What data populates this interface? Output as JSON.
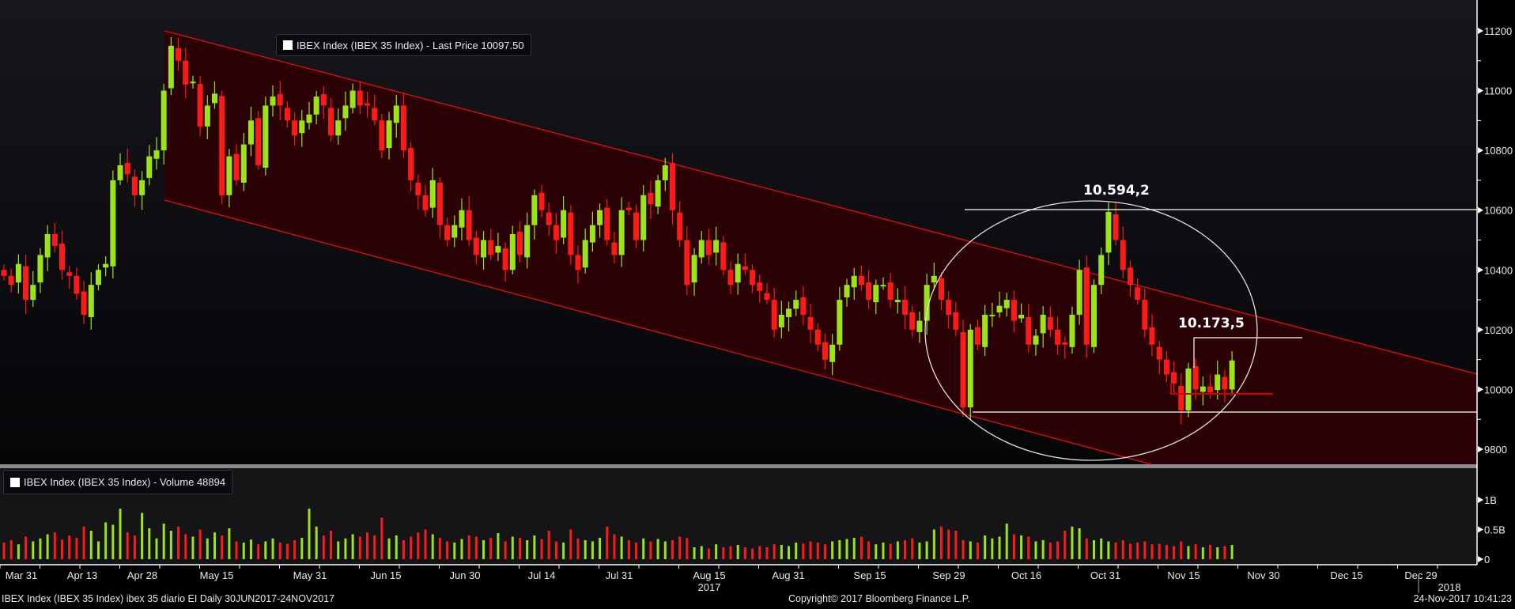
{
  "chart_data": {
    "type": "candlestick",
    "title": "IBEX Index (IBEX 35 Index) ibex 35 diario EI  Daily 30JUN2017-24NOV2017",
    "price_legend": "IBEX Index (IBEX 35 Index) - Last Price  10097.50",
    "volume_legend": "IBEX Index (IBEX 35 Index) - Volume 48894",
    "ylim": [
      9750,
      11250
    ],
    "y_ticks": [
      "11200",
      "11000",
      "10800",
      "10600",
      "10400",
      "10200",
      "10000",
      "9800"
    ],
    "volume_ylim": [
      0,
      1.05
    ],
    "volume_ticks": [
      "1B",
      "0.5B",
      "0"
    ],
    "x_ticks": [
      "Mar 31",
      "Apr 13",
      "Apr 28",
      "May 15",
      "May 31",
      "Jun 15",
      "Jun 30",
      "Jul 14",
      "Jul 31",
      "Aug 15",
      "Aug 31",
      "Sep 15",
      "Sep 29",
      "Oct 16",
      "Oct 31",
      "Nov 15",
      "Nov 30",
      "Dec 15",
      "Dec 29"
    ],
    "year_labels": [
      "2017",
      "2018"
    ],
    "annotations": {
      "high_label": "10.594,2",
      "high_value": 10594.2,
      "mid_label": "10.173,5",
      "mid_value": 10173.5,
      "low_value": 9920,
      "support_value": 9985
    },
    "colors": {
      "up": "#9be41c",
      "down": "#ff1a1a",
      "channel": "#e01010",
      "channel_fill": "#2a0206",
      "annotation": "#ffffff"
    },
    "close": [
      10380,
      10350,
      10420,
      10300,
      10350,
      10450,
      10520,
      10480,
      10400,
      10380,
      10320,
      10250,
      10350,
      10400,
      10420,
      10700,
      10750,
      10720,
      10650,
      10700,
      10780,
      10800,
      11000,
      11150,
      11100,
      11020,
      11030,
      10880,
      10950,
      10990,
      10650,
      10780,
      10700,
      10820,
      10900,
      10750,
      10950,
      10980,
      10950,
      10900,
      10850,
      10900,
      10920,
      10980,
      10950,
      10850,
      10900,
      10950,
      11000,
      10950,
      10950,
      10900,
      10800,
      10900,
      10950,
      10800,
      10700,
      10650,
      10600,
      10700,
      10550,
      10500,
      10550,
      10600,
      10500,
      10450,
      10500,
      10450,
      10480,
      10400,
      10520,
      10450,
      10550,
      10650,
      10600,
      10550,
      10500,
      10600,
      10450,
      10400,
      10500,
      10550,
      10600,
      10500,
      10450,
      10600,
      10600,
      10500,
      10650,
      10620,
      10700,
      10750,
      10600,
      10500,
      10350,
      10450,
      10500,
      10450,
      10500,
      10400,
      10350,
      10420,
      10400,
      10350,
      10330,
      10300,
      10200,
      10250,
      10270,
      10300,
      10250,
      10200,
      10150,
      10100,
      10150,
      10300,
      10350,
      10380,
      10350,
      10300,
      10350,
      10350,
      10300,
      10300,
      10250,
      10200,
      10230,
      10350,
      10380,
      10300,
      10250,
      10200,
      9940,
      10200,
      10150,
      10250,
      10250,
      10280,
      10300,
      10230,
      10250,
      10150,
      10180,
      10250,
      10200,
      10150,
      10150,
      10250,
      10400,
      10150,
      10350,
      10450,
      10594,
      10500,
      10400,
      10350,
      10300,
      10200,
      10150,
      10100,
      10050,
      10020,
      9930,
      10070,
      10000,
      10010,
      9990,
      10050,
      10000,
      10097
    ],
    "volume_billions": [
      0.28,
      0.32,
      0.25,
      0.38,
      0.3,
      0.35,
      0.42,
      0.45,
      0.33,
      0.4,
      0.36,
      0.55,
      0.48,
      0.3,
      0.62,
      0.58,
      0.85,
      0.45,
      0.4,
      0.78,
      0.52,
      0.35,
      0.6,
      0.48,
      0.55,
      0.42,
      0.38,
      0.5,
      0.35,
      0.45,
      0.4,
      0.52,
      0.3,
      0.28,
      0.33,
      0.25,
      0.3,
      0.35,
      0.28,
      0.26,
      0.32,
      0.36,
      0.85,
      0.55,
      0.4,
      0.48,
      0.3,
      0.35,
      0.42,
      0.38,
      0.45,
      0.4,
      0.7,
      0.35,
      0.4,
      0.32,
      0.38,
      0.45,
      0.5,
      0.42,
      0.36,
      0.3,
      0.28,
      0.34,
      0.4,
      0.38,
      0.32,
      0.36,
      0.44,
      0.3,
      0.38,
      0.36,
      0.32,
      0.4,
      0.34,
      0.48,
      0.3,
      0.28,
      0.5,
      0.35,
      0.32,
      0.3,
      0.36,
      0.55,
      0.42,
      0.38,
      0.32,
      0.28,
      0.35,
      0.3,
      0.34,
      0.3,
      0.32,
      0.38,
      0.36,
      0.2,
      0.22,
      0.18,
      0.25,
      0.2,
      0.22,
      0.24,
      0.2,
      0.18,
      0.22,
      0.2,
      0.25,
      0.24,
      0.22,
      0.28,
      0.26,
      0.3,
      0.28,
      0.25,
      0.3,
      0.32,
      0.34,
      0.36,
      0.38,
      0.3,
      0.25,
      0.28,
      0.26,
      0.3,
      0.32,
      0.35,
      0.28,
      0.3,
      0.5,
      0.55,
      0.5,
      0.48,
      0.32,
      0.3,
      0.28,
      0.4,
      0.35,
      0.38,
      0.6,
      0.42,
      0.4,
      0.38,
      0.3,
      0.32,
      0.28,
      0.3,
      0.48,
      0.55,
      0.52,
      0.35,
      0.32,
      0.35,
      0.3,
      0.28,
      0.32,
      0.26,
      0.28,
      0.3,
      0.25,
      0.26,
      0.24,
      0.22,
      0.3,
      0.22,
      0.25,
      0.2,
      0.24,
      0.2,
      0.22,
      0.24
    ]
  },
  "footer": {
    "description": "IBEX Index (IBEX 35 Index) ibex 35 diario EI  Daily 30JUN2017-24NOV2017",
    "copyright": "Copyright© 2017 Bloomberg Finance L.P.",
    "timestamp": "24-Nov-2017 10:41:23"
  }
}
